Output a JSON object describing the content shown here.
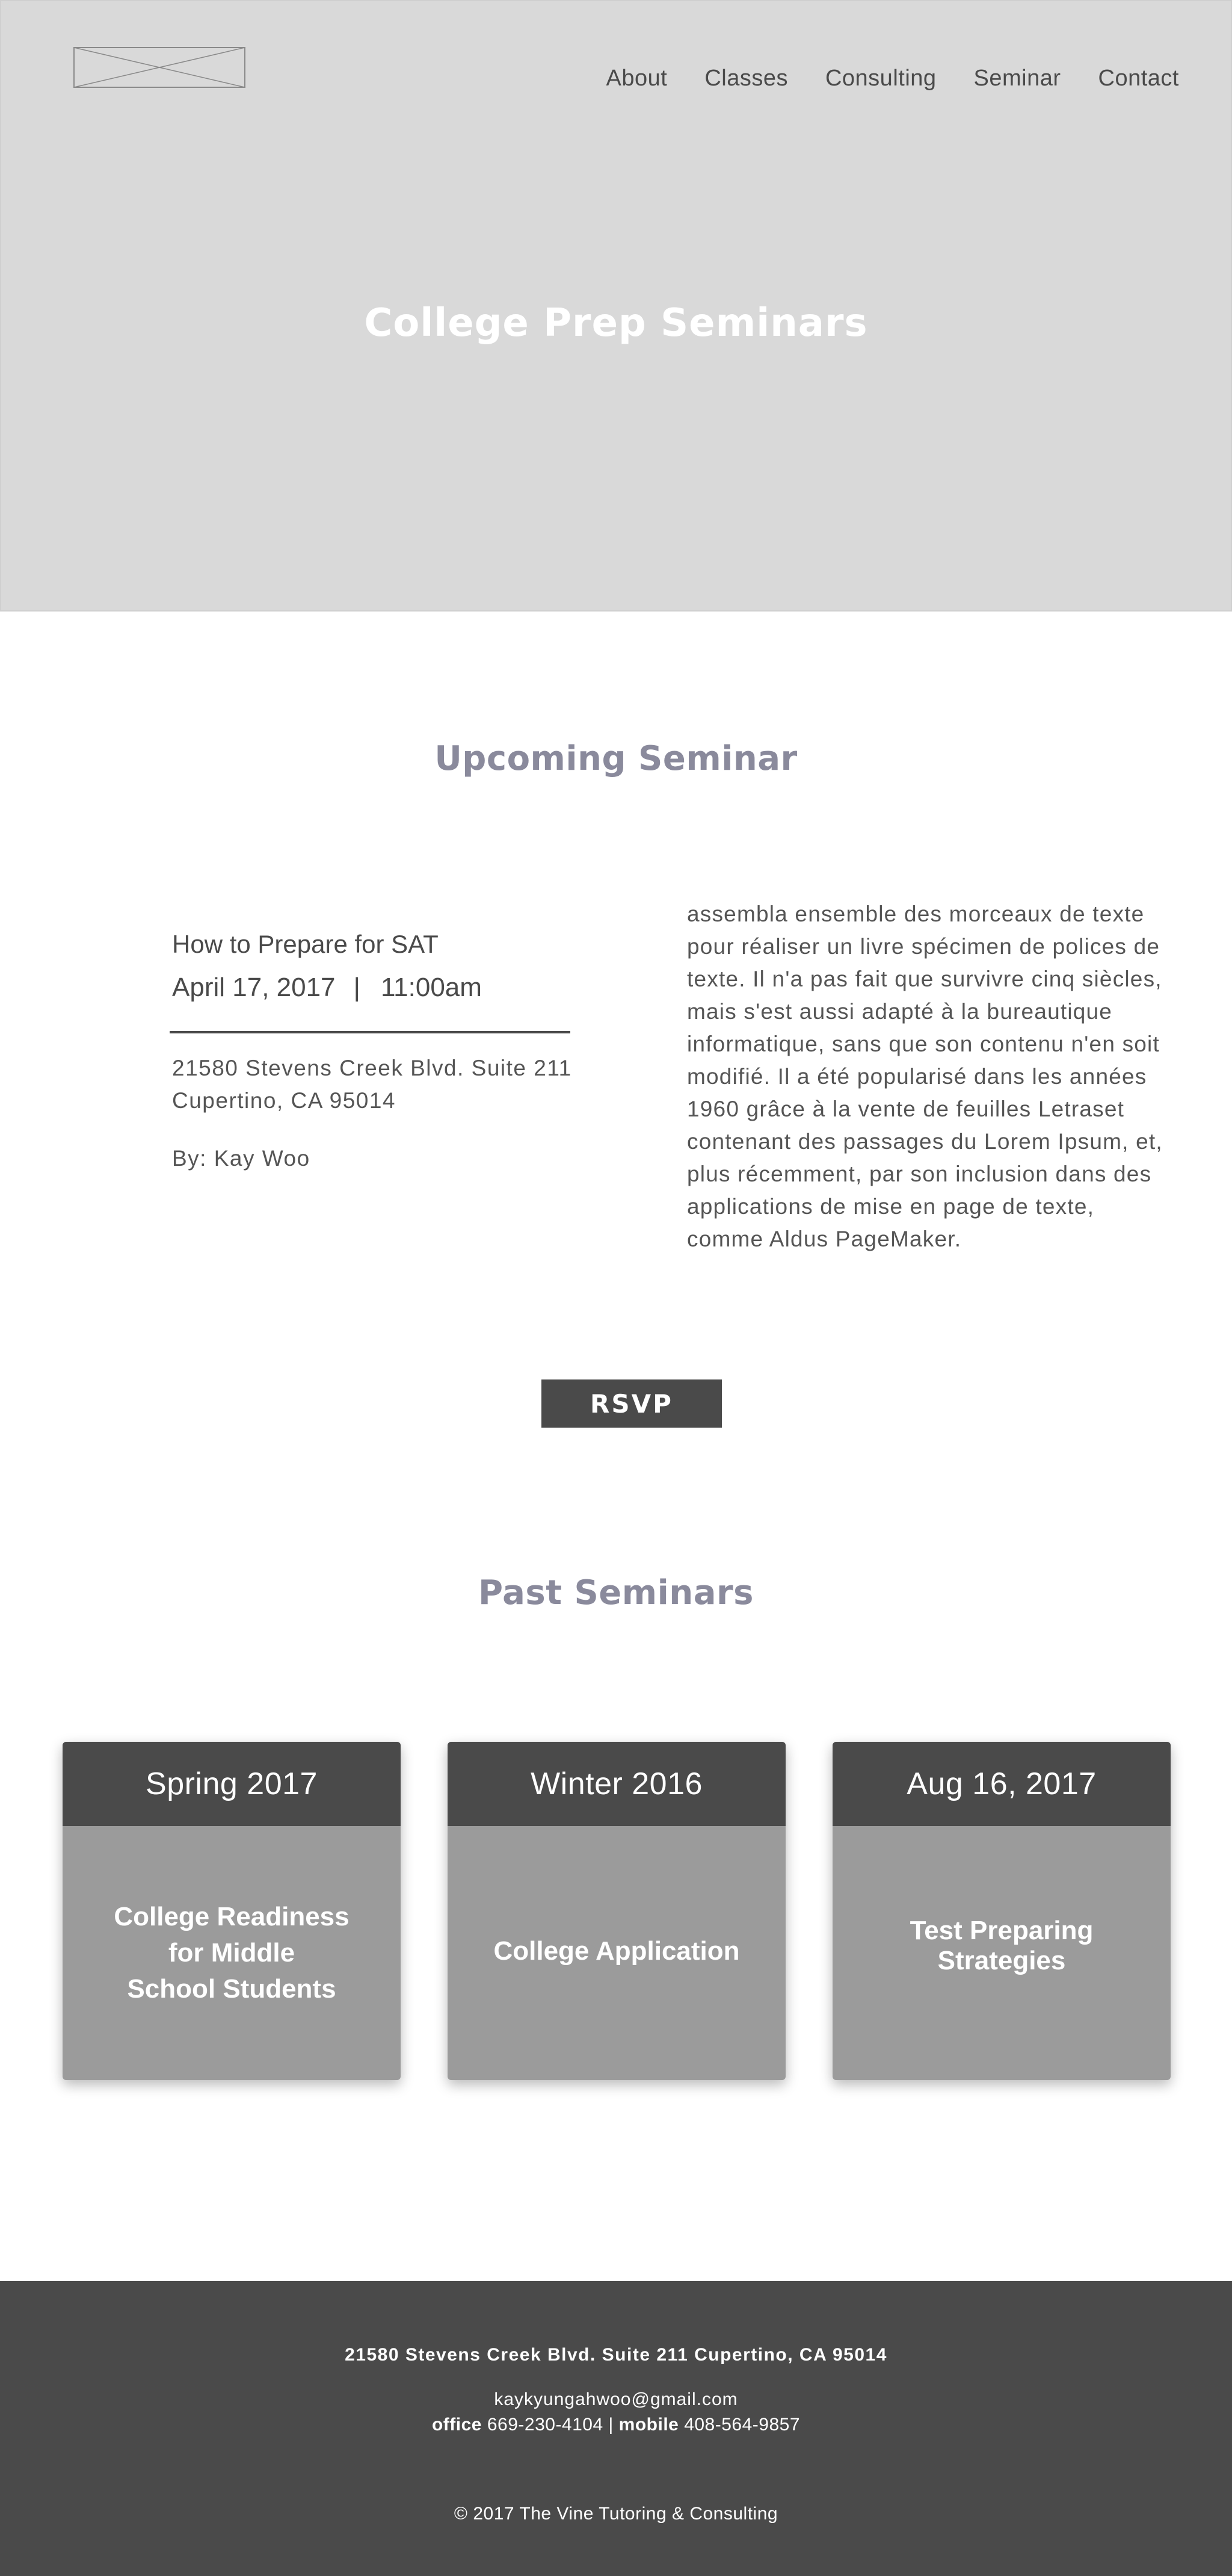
{
  "header": {
    "logo_icon": "image-placeholder-icon",
    "nav": [
      "About",
      "Classes",
      "Consulting",
      "Seminar",
      "Contact"
    ]
  },
  "hero": {
    "title": "College Prep Seminars"
  },
  "upcoming": {
    "heading": "Upcoming Seminar",
    "title": "How to Prepare for SAT",
    "date": "April 17, 2017",
    "separator": "|",
    "time": "11:00am",
    "address_line1": "21580 Stevens Creek Blvd. Suite 211",
    "address_line2": "Cupertino, CA 95014",
    "by": "By: Kay Woo",
    "description": "assembla ensemble des morceaux de texte pour réaliser un livre spécimen de polices de texte. Il n'a pas fait que survivre cinq siècles, mais s'est aussi adapté à la bureautique informatique, sans que son contenu n'en soit modifié. Il a été popularisé dans les années 1960 grâce à la vente de feuilles Letraset contenant des passages du Lorem Ipsum, et, plus récemment, par son inclusion dans des applications de mise en page de texte, comme Aldus PageMaker.",
    "rsvp_label": "RSVP"
  },
  "past": {
    "heading": "Past Seminars",
    "cards": [
      {
        "date": "Spring 2017",
        "title": "College Readiness\nfor Middle\nSchool Students"
      },
      {
        "date": "Winter 2016",
        "title": "College Application"
      },
      {
        "date": "Aug 16, 2017",
        "title": "Test Preparing\nStrategies"
      }
    ]
  },
  "footer": {
    "address": "21580 Stevens Creek Blvd. Suite 211 Cupertino, CA 95014",
    "email": "kaykyungahwoo@gmail.com",
    "office_label": "office",
    "office_phone": "669-230-4104",
    "divider": "|",
    "mobile_label": "mobile",
    "mobile_phone": "408-564-9857",
    "copyright": "© 2017 The Vine Tutoring & Consulting"
  },
  "colors": {
    "hero_bg": "#d9d9d9",
    "dark": "#4a4a4a",
    "heading": "#8a8a9c",
    "card_body": "#9b9b9b"
  }
}
